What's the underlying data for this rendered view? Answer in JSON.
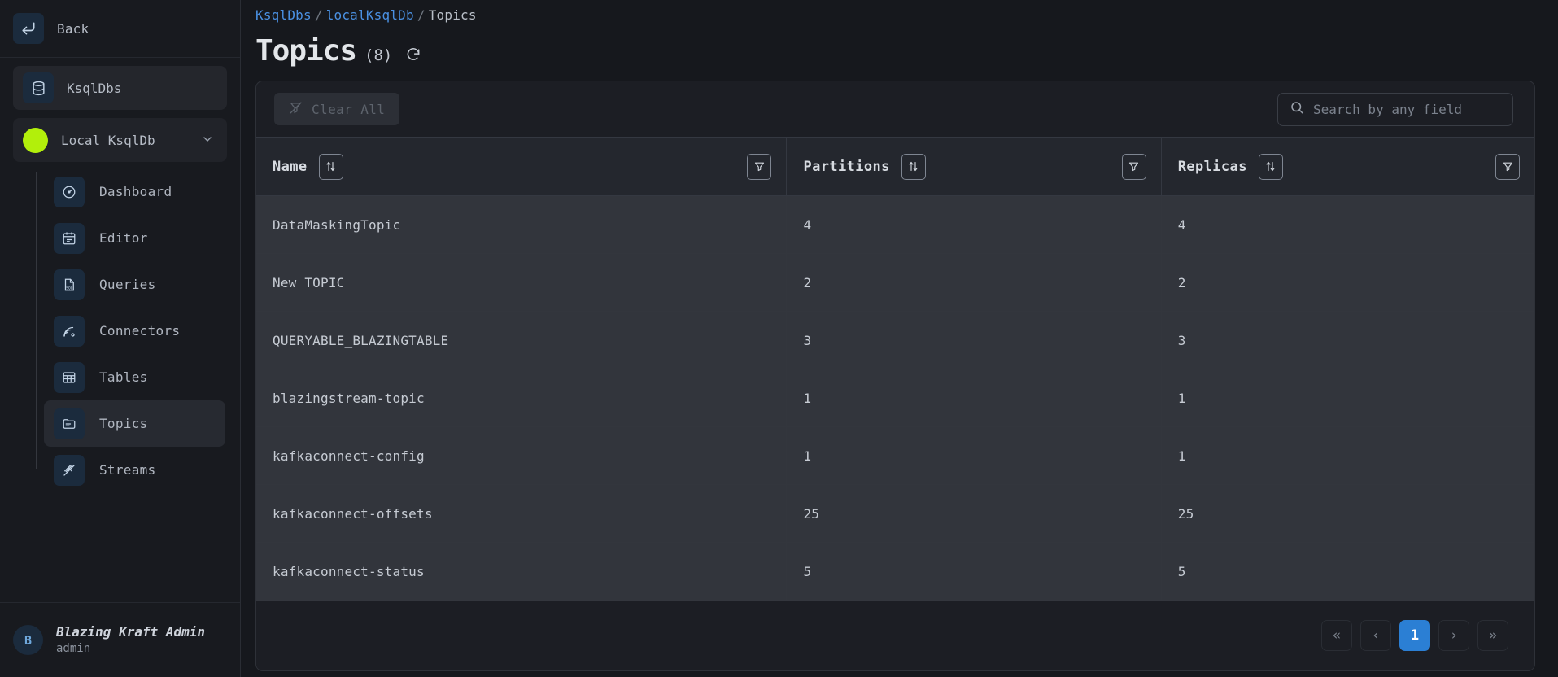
{
  "sidebar": {
    "back_label": "Back",
    "section_label": "KsqlDbs",
    "cluster_label": "Local KsqlDb",
    "cluster_status_color": "#b2ef0b",
    "nav_items": [
      {
        "label": "Dashboard",
        "icon": "gauge-icon",
        "active": false
      },
      {
        "label": "Editor",
        "icon": "editor-icon",
        "active": false
      },
      {
        "label": "Queries",
        "icon": "sql-file-icon",
        "active": false
      },
      {
        "label": "Connectors",
        "icon": "connectors-icon",
        "active": false
      },
      {
        "label": "Tables",
        "icon": "table-grid-icon",
        "active": false
      },
      {
        "label": "Topics",
        "icon": "folder-icon",
        "active": true
      },
      {
        "label": "Streams",
        "icon": "streams-icon",
        "active": false
      }
    ],
    "user": {
      "initial": "B",
      "name": "Blazing Kraft Admin",
      "role": "admin"
    }
  },
  "breadcrumb": {
    "root": "KsqlDbs",
    "cluster": "localKsqlDb",
    "current": "Topics",
    "separator": "/"
  },
  "header": {
    "title": "Topics",
    "count": "(8)",
    "refresh_label": "refresh"
  },
  "toolbar": {
    "clear_all_label": "Clear All",
    "search_placeholder": "Search by any field",
    "search_value": ""
  },
  "table": {
    "columns": [
      {
        "label": "Name",
        "sort_icon": "sort-icon",
        "filter_icon": "filter-icon"
      },
      {
        "label": "Partitions",
        "sort_icon": "sort-icon",
        "filter_icon": "filter-icon"
      },
      {
        "label": "Replicas",
        "sort_icon": "sort-icon",
        "filter_icon": "filter-icon"
      }
    ],
    "rows": [
      {
        "name": "DataMaskingTopic",
        "partitions": "4",
        "replicas": "4"
      },
      {
        "name": "New_TOPIC",
        "partitions": "2",
        "replicas": "2"
      },
      {
        "name": "QUERYABLE_BLAZINGTABLE",
        "partitions": "3",
        "replicas": "3"
      },
      {
        "name": "blazingstream-topic",
        "partitions": "1",
        "replicas": "1"
      },
      {
        "name": "kafkaconnect-config",
        "partitions": "1",
        "replicas": "1"
      },
      {
        "name": "kafkaconnect-offsets",
        "partitions": "25",
        "replicas": "25"
      },
      {
        "name": "kafkaconnect-status",
        "partitions": "5",
        "replicas": "5"
      }
    ]
  },
  "pagination": {
    "first": "«",
    "prev": "‹",
    "current_page": "1",
    "next": "›",
    "last": "»"
  },
  "colors": {
    "accent_blue": "#2b7fd4",
    "link_blue": "#4a90e2",
    "status_green": "#b2ef0b"
  }
}
